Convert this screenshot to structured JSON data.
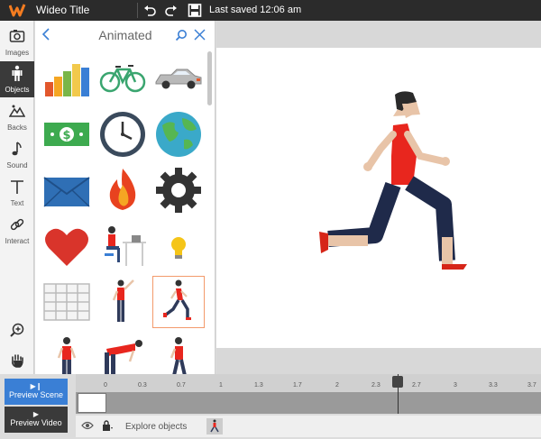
{
  "header": {
    "title": "Wideo Title",
    "saved": "Last saved 12:06 am"
  },
  "sidebar": {
    "items": [
      {
        "label": "Images"
      },
      {
        "label": "Objects"
      },
      {
        "label": "Backs"
      },
      {
        "label": "Sound"
      },
      {
        "label": "Text"
      },
      {
        "label": "Interact"
      }
    ]
  },
  "panel": {
    "title": "Animated"
  },
  "timeline": {
    "preview_scene": "Preview Scene",
    "preview_video": "Preview Video",
    "ticks": [
      "0",
      "0.3",
      "0.7",
      "1",
      "1.3",
      "1.7",
      "2",
      "2.3",
      "2.7",
      "3",
      "3.3",
      "3.7"
    ],
    "explore": "Explore objects"
  },
  "colors": {
    "accent": "#3a7fd5",
    "selected_outline": "#f39a6b",
    "runner_shirt": "#e8261e"
  }
}
